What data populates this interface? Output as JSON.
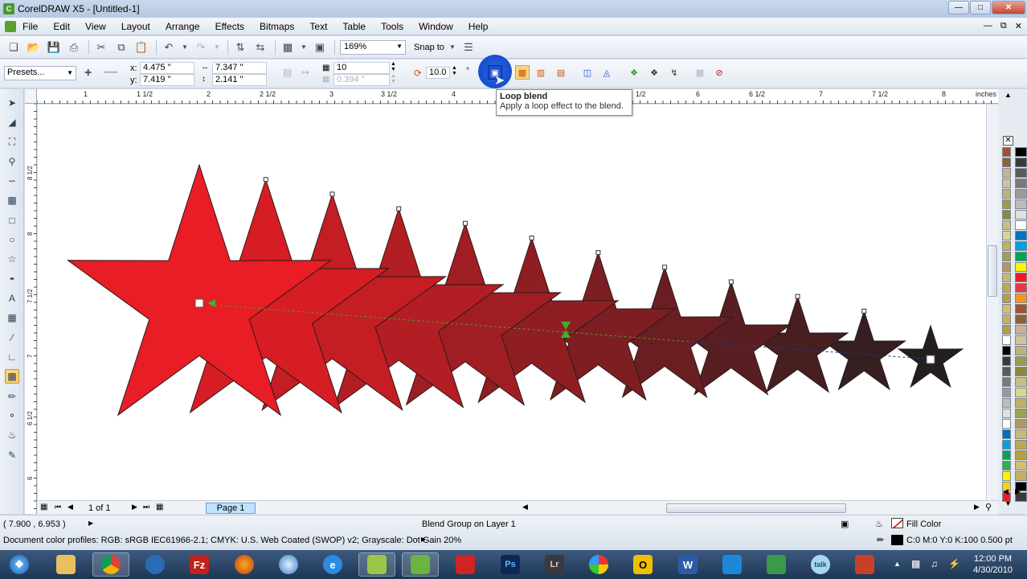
{
  "window": {
    "title": "CorelDRAW X5 - [Untitled-1]"
  },
  "menu": [
    "File",
    "Edit",
    "View",
    "Layout",
    "Arrange",
    "Effects",
    "Bitmaps",
    "Text",
    "Table",
    "Tools",
    "Window",
    "Help"
  ],
  "standard_toolbar": {
    "zoom": "169%",
    "snap_to": "Snap to"
  },
  "property_bar": {
    "presets": "Presets...",
    "x": "4.475 \"",
    "y": "7.419 \"",
    "width": "7.347 \"",
    "height": "2.141 \"",
    "x_label": "x:",
    "y_label": "y:",
    "steps": "10",
    "spacing": "0.394 \"",
    "rotation": "10.0",
    "degree": "°"
  },
  "tooltip": {
    "title": "Loop blend",
    "text": "Apply a loop effect to the blend."
  },
  "ruler": {
    "units": "inches",
    "h_labels": [
      "1",
      "1 1/2",
      "2",
      "2 1/2",
      "3",
      "3 1/2",
      "4",
      "1/2",
      "6",
      "6 1/2",
      "7",
      "7 1/2",
      "8"
    ],
    "v_labels": [
      "8 1/2",
      "8",
      "7 1/2",
      "7",
      "6 1/2",
      "6"
    ]
  },
  "page_nav": {
    "counter": "1 of 1",
    "page_tab": "Page 1"
  },
  "status": {
    "cursor": "( 7.900 , 6.953 )",
    "object": "Blend Group on Layer 1",
    "profiles": "Document color profiles: RGB: sRGB IEC61966-2.1; CMYK: U.S. Web Coated (SWOP) v2; Grayscale: Dot Gain 20%",
    "fill": "Fill Color",
    "outline": "C:0 M:0 Y:0 K:100  0.500 pt"
  },
  "taskbar": {
    "time": "12:00 PM",
    "date": "4/30/2010",
    "ps": "Ps",
    "lr": "Lr"
  },
  "colors": {
    "start_star": "#e81d25",
    "end_star": "#231f1f",
    "selection_blue": "#1a52d6"
  },
  "palette": [
    "#ffffff",
    "#000000",
    "#3a3a3a",
    "#5a5a5a",
    "#7a7a7a",
    "#9a9a9a",
    "#bcbcbc",
    "#e0e0e0",
    "#ffffff",
    "#0070c0",
    "#00a0e0",
    "#00a651",
    "#2db34a",
    "#fff200",
    "#f7d117",
    "#ed1c24",
    "#e63946",
    "#f7941d",
    "#a0522d",
    "#8c6239",
    "#c7b299",
    "#d2c29d",
    "#bfb27a",
    "#9e9a4c",
    "#8a8a3c",
    "#c8c080",
    "#d8d890",
    "#c0b060",
    "#a0a050",
    "#b09860",
    "#c8b878",
    "#c0a850",
    "#b8a040",
    "#d0c070",
    "#c8b060",
    "#b0a048"
  ]
}
